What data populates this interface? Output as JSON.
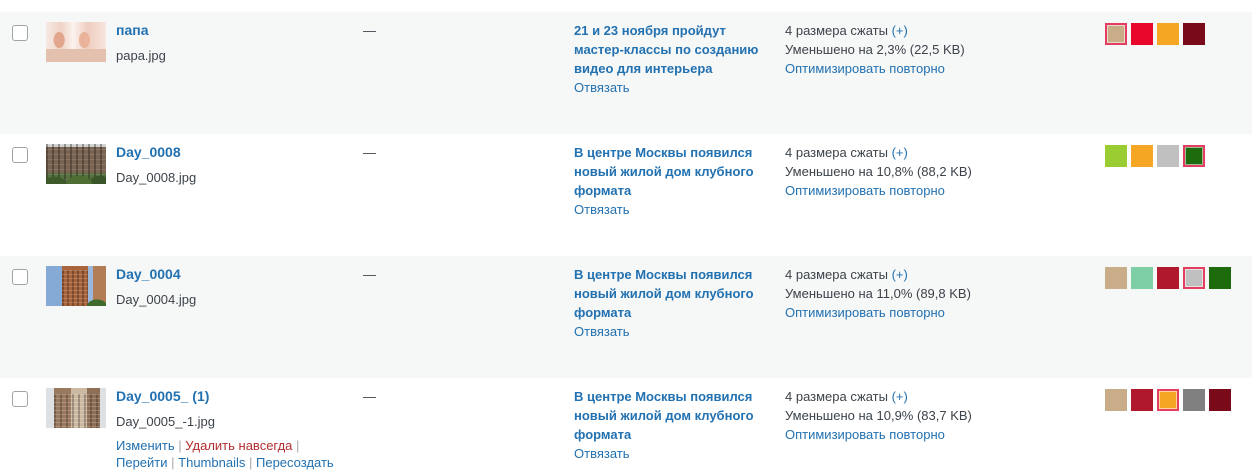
{
  "colors": {
    "link": "#2271b1",
    "text": "#3c434a",
    "delete": "#b32d2e",
    "separator": "#a7aaad",
    "row_alt_bg": "#f6f7f7",
    "swatch_selected": "#e43d5f"
  },
  "rows": [
    {
      "title": "папа",
      "filename": "papa.jpg",
      "author": "—",
      "attached_post": "21 и 23 ноября пройдут мастер-классы по созданию видео для интерьера",
      "detach": "Отвязать",
      "compressed": "4 размера сжаты",
      "expand": "(+)",
      "reduced": "Уменьшено на 2,3% (22,5 KB)",
      "reoptimize": "Оптимизировать повторно",
      "swatches": [
        "#c9ad88",
        "#e8062b",
        "#f5a623",
        "#790a1a"
      ],
      "selected_swatch": 0
    },
    {
      "title": "Day_0008",
      "filename": "Day_0008.jpg",
      "author": "—",
      "attached_post": "В центре Москвы появился новый жилой дом клубного формата",
      "detach": "Отвязать",
      "compressed": "4 размера сжаты",
      "expand": "(+)",
      "reduced": "Уменьшено на 10,8% (88,2 KB)",
      "reoptimize": "Оптимизировать повторно",
      "swatches": [
        "#9acd32",
        "#f5a623",
        "#c0c0c0",
        "#1e6b0e"
      ],
      "selected_swatch": 3
    },
    {
      "title": "Day_0004",
      "filename": "Day_0004.jpg",
      "author": "—",
      "attached_post": "В центре Москвы появился новый жилой дом клубного формата",
      "detach": "Отвязать",
      "compressed": "4 размера сжаты",
      "expand": "(+)",
      "reduced": "Уменьшено на 11,0% (89,8 KB)",
      "reoptimize": "Оптимизировать повторно",
      "swatches": [
        "#c9ad88",
        "#7dcfa6",
        "#b0182e",
        "#c0c0c0",
        "#1e6b0e"
      ],
      "selected_swatch": 3
    },
    {
      "title": "Day_0005_ (1)",
      "filename": "Day_0005_-1.jpg",
      "author": "—",
      "attached_post": "В центре Москвы появился новый жилой дом клубного формата",
      "detach": "Отвязать",
      "compressed": "4 размера сжаты",
      "expand": "(+)",
      "reduced": "Уменьшено на 10,9% (83,7 KB)",
      "reoptimize": "Оптимизировать повторно",
      "swatches": [
        "#c9ad88",
        "#b0182e",
        "#f5a623",
        "#808080",
        "#790a1a"
      ],
      "selected_swatch": 2,
      "actions": {
        "edit": "Изменить",
        "delete": "Удалить навсегда",
        "view": "Перейти",
        "thumbnails": "Thumbnails",
        "regenerate": "Пересоздать",
        "separator": "|"
      }
    }
  ]
}
